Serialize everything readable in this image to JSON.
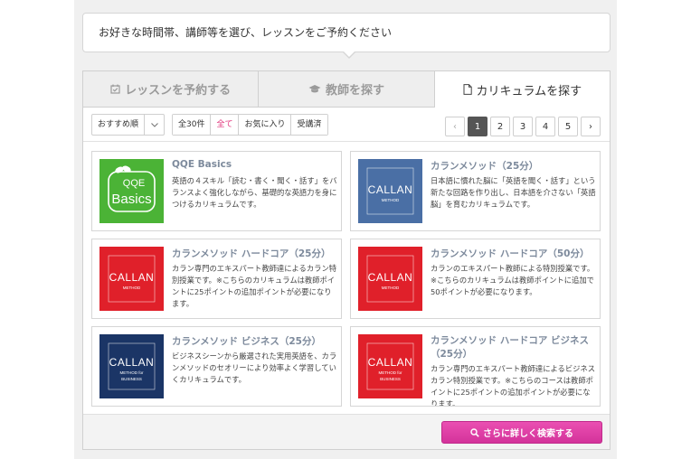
{
  "banner": {
    "text": "お好きな時間帯、講師等を選び、レッスンをご予約ください"
  },
  "tabs": [
    {
      "label": "レッスンを予約する",
      "active": false
    },
    {
      "label": "教師を探す",
      "active": false
    },
    {
      "label": "カリキュラムを探す",
      "active": true
    }
  ],
  "toolbar": {
    "sort_value": "おすすめ順",
    "filters": [
      {
        "label": "全30件",
        "active": false
      },
      {
        "label": "全て",
        "active": true
      },
      {
        "label": "お気に入り",
        "active": false
      },
      {
        "label": "受講済",
        "active": false
      }
    ]
  },
  "pager": {
    "prev": "‹",
    "pages": [
      "1",
      "2",
      "3",
      "4",
      "5"
    ],
    "current": "1",
    "next": "›"
  },
  "cards": [
    {
      "title": "QQE Basics",
      "desc": "英語の４スキル「読む・書く・聞く・話す」をバランスよく強化しながら、基礎的な英語力を身につけるカリキュラムです。",
      "thumb": {
        "type": "qqe",
        "line1": "QQE",
        "line2": "Basics",
        "color": "#4bb336"
      }
    },
    {
      "title": "カランメソッド（25分）",
      "desc": "日本語に慣れた脳に「英語を聞く・話す」という新たな回路を作り出し、日本語を介さない「英語脳」を育むカリキュラムです。",
      "thumb": {
        "type": "callan",
        "logo": "CALLAN",
        "sub1": "METHOD",
        "sub2": "",
        "color": "#4a6fa5"
      }
    },
    {
      "title": "カランメソッド ハードコア（25分）",
      "desc": "カラン専門のエキスパート教師達によるカラン特別授業です。※こちらのカリキュラムは教師ポイントに25ポイントの追加ポイントが必要になります。",
      "thumb": {
        "type": "callan",
        "logo": "CALLAN",
        "sub1": "METHOD",
        "sub2": "",
        "color": "#e0202a"
      }
    },
    {
      "title": "カランメソッド ハードコア（50分）",
      "desc": "カランのエキスパート教師による特別授業です。※こちらのカリキュラムは教師ポイントに追加で50ポイントが必要になります。",
      "thumb": {
        "type": "callan",
        "logo": "CALLAN",
        "sub1": "METHOD",
        "sub2": "",
        "color": "#e0202a"
      }
    },
    {
      "title": "カランメソッド ビジネス（25分）",
      "desc": "ビジネスシーンから厳選された実用英語を、カランメソッドのセオリーにより効率よく学習していくカリキュラムです。",
      "thumb": {
        "type": "callan",
        "logo": "CALLAN",
        "sub1": "METHOD for",
        "sub2": "BUSINESS",
        "color": "#1b3566"
      }
    },
    {
      "title": "カランメソッド ハードコア ビジネス（25分）",
      "desc": "カラン専門のエキスパート教師達によるビジネスカラン特別授業です。※こちらのコースは教師ポイントに25ポイントの追加ポイントが必要になります。",
      "thumb": {
        "type": "callan",
        "logo": "CALLAN",
        "sub1": "METHOD for",
        "sub2": "BUSINESS",
        "color": "#e0202a"
      }
    }
  ],
  "footer": {
    "search_label": "さらに詳しく検索する"
  },
  "colors": {
    "accent_pink": "#dd3fa6",
    "filter_active": "#e0337a"
  }
}
